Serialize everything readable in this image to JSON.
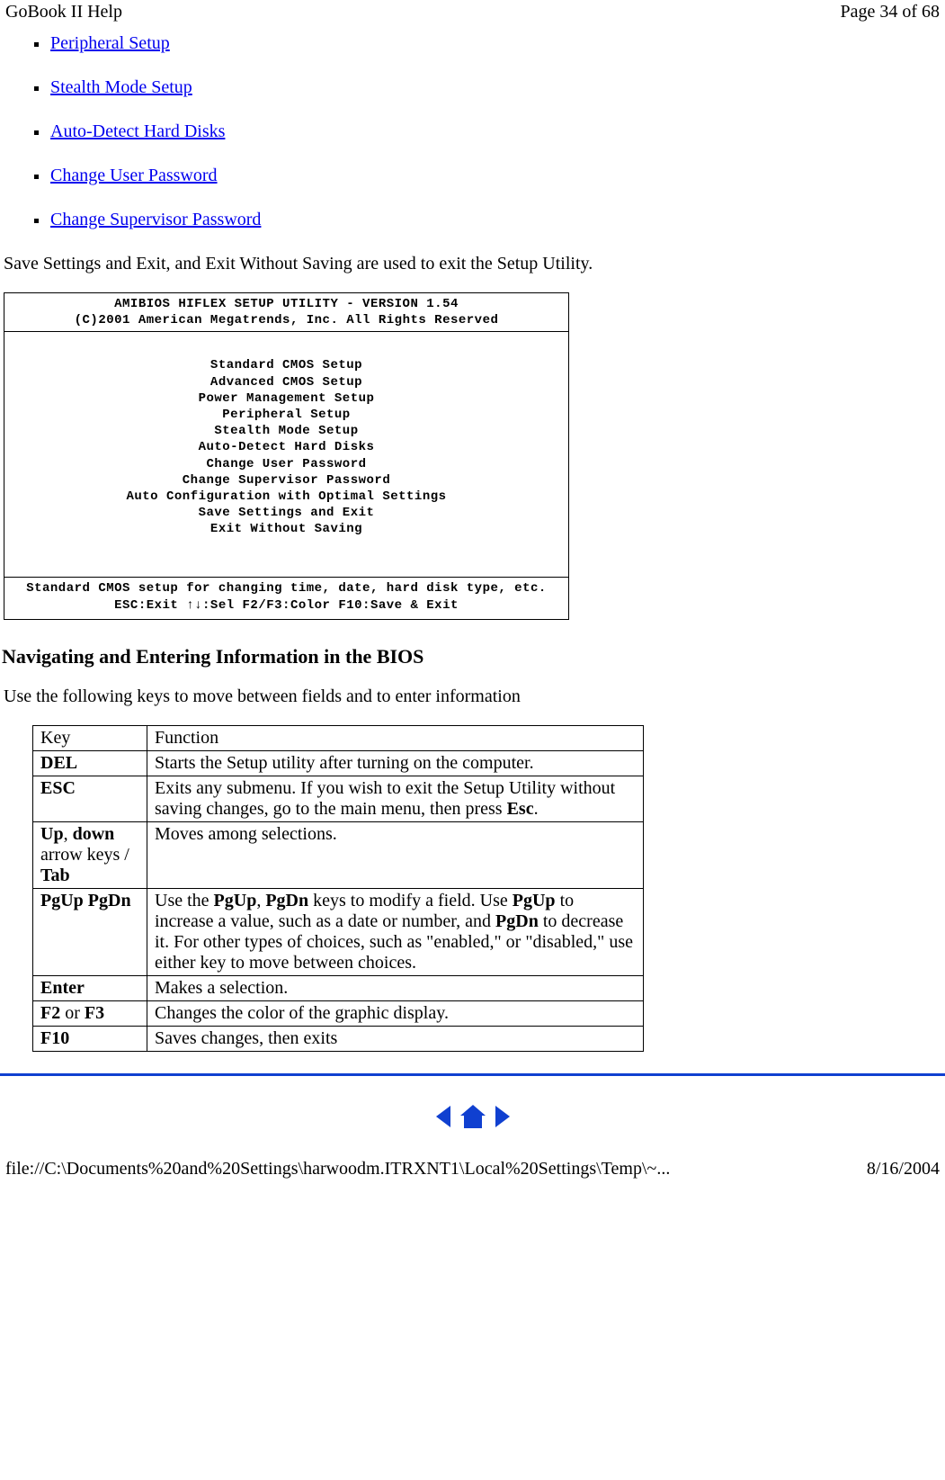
{
  "header": {
    "title_left": "GoBook II Help",
    "title_right": "Page 34 of 68"
  },
  "links": [
    "Peripheral Setup",
    "Stealth Mode Setup",
    "Auto-Detect Hard Disks",
    "Change User Password",
    "Change Supervisor Password"
  ],
  "intro_text": "Save Settings and Exit, and Exit Without Saving are used to exit the Setup Utility.",
  "bios": {
    "title1": "AMIBIOS HIFLEX SETUP UTILITY - VERSION 1.54",
    "title2": "(C)2001 American Megatrends, Inc. All Rights Reserved",
    "menu": [
      "Standard CMOS Setup",
      "Advanced CMOS Setup",
      "Power Management Setup",
      "Peripheral Setup",
      "Stealth Mode Setup",
      "Auto-Detect Hard Disks",
      "Change User Password",
      "Change Supervisor Password",
      "Auto Configuration with Optimal Settings",
      "Save Settings and Exit",
      "Exit Without Saving"
    ],
    "foot1": "Standard CMOS setup for changing time, date, hard disk type, etc.",
    "foot2": "ESC:Exit  ↑↓:Sel  F2/F3:Color  F10:Save & Exit"
  },
  "section_heading": "Navigating and Entering Information in the BIOS",
  "section_intro": "Use the following keys to move between fields and to enter information",
  "table": {
    "head": {
      "c1": "Key",
      "c2": "Function"
    },
    "rows": [
      {
        "key_parts": [
          {
            "t": "DEL",
            "b": true
          }
        ],
        "fn_parts": [
          {
            "t": "Starts the Setup utility after turning on the computer."
          }
        ]
      },
      {
        "key_parts": [
          {
            "t": "ESC",
            "b": true
          }
        ],
        "fn_parts": [
          {
            "t": "Exits any submenu.  If you wish to exit the Setup Utility without saving changes, go to the main menu, then press "
          },
          {
            "t": "Esc",
            "b": true
          },
          {
            "t": "."
          }
        ]
      },
      {
        "key_parts": [
          {
            "t": "Up",
            "b": true
          },
          {
            "t": ", "
          },
          {
            "t": "down",
            "b": true
          },
          {
            "t": " arrow keys / "
          },
          {
            "t": "Tab",
            "b": true
          }
        ],
        "fn_parts": [
          {
            "t": "Moves among selections."
          }
        ]
      },
      {
        "key_parts": [
          {
            "t": "PgUp",
            "b": true
          },
          {
            "t": " "
          },
          {
            "t": "PgDn",
            "b": true
          }
        ],
        "fn_parts": [
          {
            "t": "Use the "
          },
          {
            "t": "PgUp",
            "b": true
          },
          {
            "t": ", "
          },
          {
            "t": "PgDn",
            "b": true
          },
          {
            "t": " keys to modify a field.  Use "
          },
          {
            "t": "PgUp",
            "b": true
          },
          {
            "t": " to increase a value, such as a date or number, and "
          },
          {
            "t": "PgDn",
            "b": true
          },
          {
            "t": " to decrease it.  For other types of choices, such as \"enabled,\" or \"disabled,\" use either key to move between choices."
          }
        ]
      },
      {
        "key_parts": [
          {
            "t": "Enter",
            "b": true
          }
        ],
        "fn_parts": [
          {
            "t": "Makes a selection."
          }
        ]
      },
      {
        "key_parts": [
          {
            "t": "F2",
            "b": true
          },
          {
            "t": " or "
          },
          {
            "t": "F3",
            "b": true
          }
        ],
        "fn_parts": [
          {
            "t": "Changes the color of the graphic display."
          }
        ]
      },
      {
        "key_parts": [
          {
            "t": "F10",
            "b": true
          }
        ],
        "fn_parts": [
          {
            "t": "Saves changes, then exits"
          }
        ]
      }
    ]
  },
  "footer": {
    "path": "file://C:\\Documents%20and%20Settings\\harwoodm.ITRXNT1\\Local%20Settings\\Temp\\~...",
    "date": "8/16/2004"
  }
}
